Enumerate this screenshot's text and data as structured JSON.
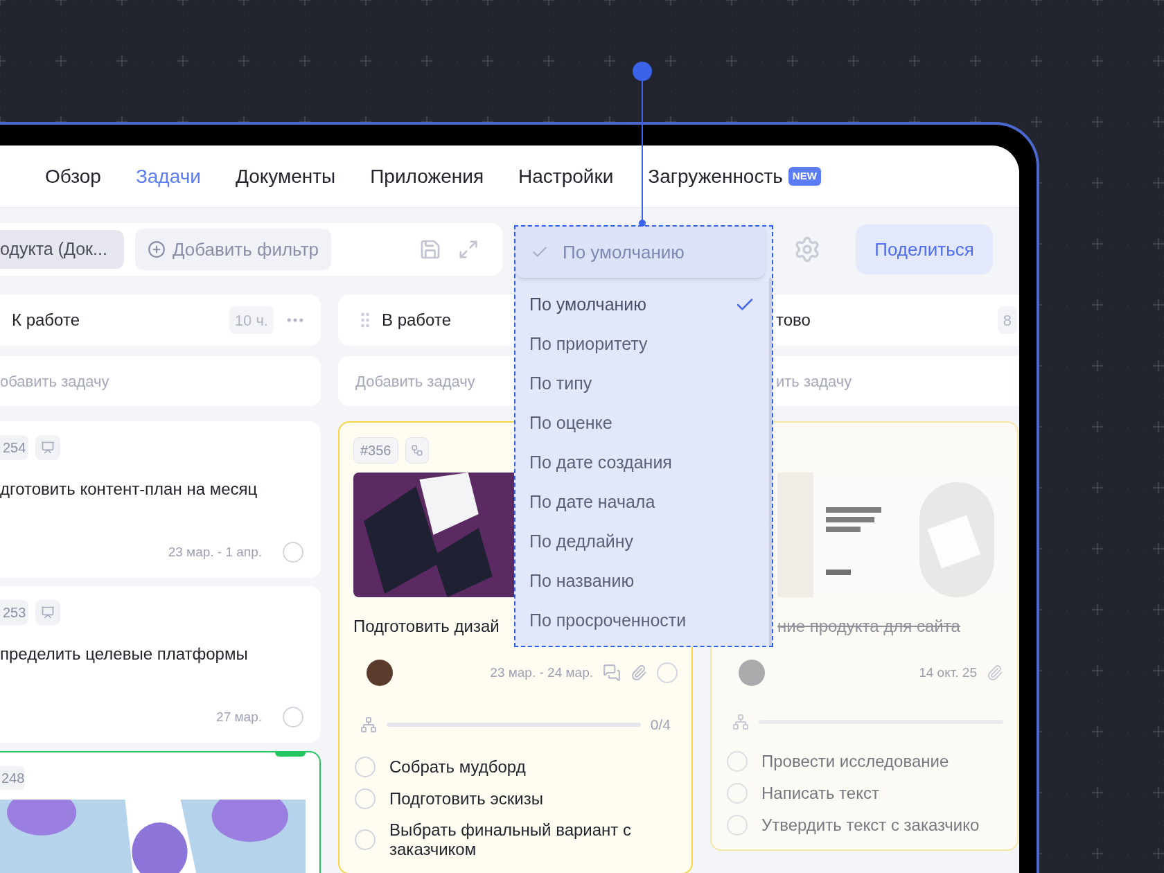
{
  "nav": {
    "tabs": [
      {
        "label": "Обзор",
        "selected": false
      },
      {
        "label": "Задачи",
        "selected": true
      },
      {
        "label": "Документы",
        "selected": false
      },
      {
        "label": "Приложения",
        "selected": false
      },
      {
        "label": "Настройки",
        "selected": false
      },
      {
        "label": "Загруженность",
        "selected": false,
        "badge": "NEW"
      }
    ]
  },
  "toolbar": {
    "filter_chip": "одукта (Док...",
    "add_filter": "Добавить фильтр",
    "share": "Поделиться"
  },
  "sort_menu": {
    "current": "По умолчанию",
    "options": [
      {
        "label": "По умолчанию",
        "selected": true
      },
      {
        "label": "По приоритету",
        "selected": false
      },
      {
        "label": "По типу",
        "selected": false
      },
      {
        "label": "По оценке",
        "selected": false
      },
      {
        "label": "По дате создания",
        "selected": false
      },
      {
        "label": "По дате начала",
        "selected": false
      },
      {
        "label": "По дедлайну",
        "selected": false
      },
      {
        "label": "По названию",
        "selected": false
      },
      {
        "label": "По просроченности",
        "selected": false
      }
    ]
  },
  "columns": [
    {
      "title": "К работе",
      "hours": "10 ч.",
      "add_task": "обавить задачу",
      "cards": [
        {
          "kind": "task",
          "id": "254",
          "title": "дготовить контент-план на месяц",
          "date": "23 мар. - 1 апр.",
          "done": false
        },
        {
          "kind": "task",
          "id": "253",
          "title": "пределить целевые платформы",
          "date": "27 мар.",
          "done": false
        },
        {
          "kind": "illustration",
          "id": "248",
          "color": "#22c55e"
        }
      ]
    },
    {
      "title": "В работе",
      "add_task": "Добавить задачу",
      "cards": [
        {
          "kind": "photo",
          "id": "#356",
          "title": "Подготовить дизай",
          "date": "23 мар. - 24 мар.",
          "done": false,
          "color": "#f5d547",
          "progress": {
            "level": 0,
            "count": "0/4"
          },
          "checklist": [
            {
              "text": "Собрать мудборд",
              "checked": false
            },
            {
              "text": "Подготовить эскизы",
              "checked": false
            },
            {
              "text": "Выбрать финальный вариант с заказчиком",
              "checked": false
            }
          ]
        }
      ]
    },
    {
      "title": "тово",
      "hours": "8",
      "add_task": "ить задачу",
      "cards": [
        {
          "kind": "website",
          "title": "ние продукта для сайта",
          "date": "14 окт. 25",
          "done": true,
          "color": "#f3e6a6",
          "progress": {
            "level": 0
          },
          "checklist": [
            {
              "text": "Провести исследование",
              "checked": false
            },
            {
              "text": "Написать текст",
              "checked": false
            },
            {
              "text": "Утвердить текст с заказчико",
              "checked": false
            }
          ]
        }
      ]
    }
  ]
}
